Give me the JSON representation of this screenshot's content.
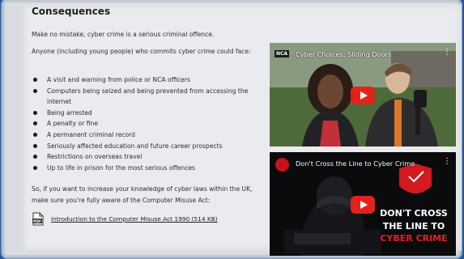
{
  "section": {
    "title": "Consequences",
    "intro": "Make no mistake, cyber crime is a serious criminal offence.",
    "lead": "Anyone (including young people) who commits cyber crime could face:",
    "consequences": [
      "A visit and warning from police or NCA officers",
      "Computers being seized and being prevented from accessing the internet",
      "Being arrested",
      "A penalty or fine",
      "A permanent criminal record",
      "Seriously affected education and future career prospects",
      "Restrictions on overseas travel",
      "Up to life in prison for the most serious offences"
    ],
    "closing": "So, if you want to increase your knowledge of cyber laws within the UK, make sure you're fully aware of the Computer Misuse Act:",
    "pdf_link": "Introduction to the Computer Misuse Act 1990 (514 KB)"
  },
  "videos": [
    {
      "title": "Cyber Choices: Sliding Doors",
      "channel_badge": "NCA"
    },
    {
      "title": "Don't Cross the Line to Cyber Crime",
      "overlay_lines": [
        "DON'T CROSS",
        "THE LINE TO",
        "CYBER CRIME"
      ]
    }
  ],
  "icons": {
    "pdf": "pdf-file-icon",
    "play": "youtube-play-icon",
    "more": "more-vertical-icon"
  },
  "colors": {
    "youtube_red": "#e3221b",
    "accent_red": "#e02020",
    "background_blue": "#1f56a8"
  }
}
